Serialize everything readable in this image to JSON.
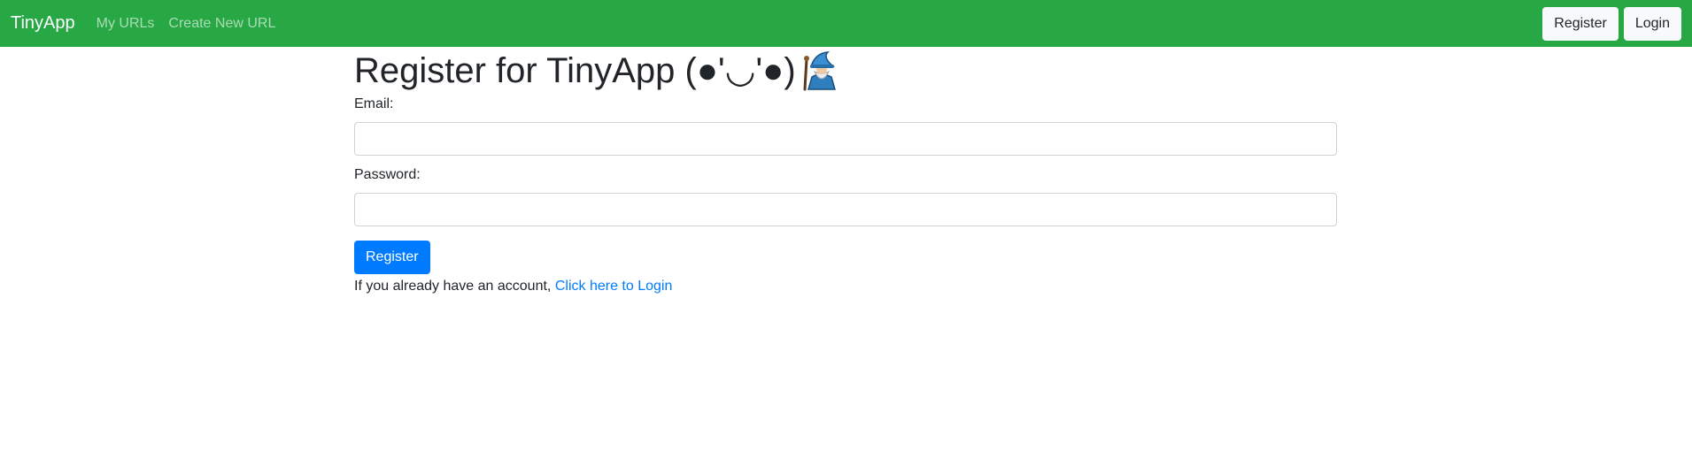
{
  "navbar": {
    "brand": "TinyApp",
    "links": [
      "My URLs",
      "Create New URL"
    ],
    "register_label": "Register",
    "login_label": "Login",
    "background": "#28a745"
  },
  "page": {
    "title": "Register for TinyApp (●'◡'●)",
    "title_icon": "wizard-emoji-icon"
  },
  "form": {
    "email_label": "Email:",
    "email_value": "",
    "password_label": "Password:",
    "password_value": "",
    "submit_label": "Register",
    "submit_color": "#007bff"
  },
  "footer": {
    "prompt": "If you already have an account,",
    "login_link": "Click here to Login"
  }
}
